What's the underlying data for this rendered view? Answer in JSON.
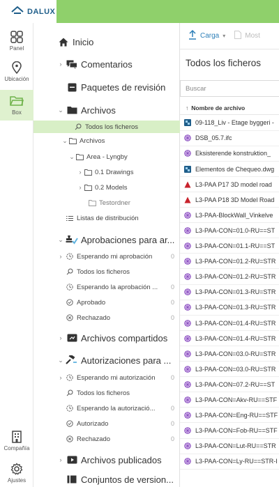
{
  "app": {
    "logo_text": "DALUX"
  },
  "rail": {
    "panel": "Panel",
    "location": "Ubicación",
    "box": "Box",
    "company": "Compañía",
    "settings": "Ajustes"
  },
  "nav": {
    "inicio": "Inicio",
    "comentarios": "Comentarios",
    "paquetes": "Paquetes de revisión",
    "archivos": "Archivos",
    "todos": "Todos los ficheros",
    "archivos_folder": "Archivos",
    "area": "Area - Lyngby",
    "drawings": "0.1 Drawings",
    "models": "0.2 Models",
    "testordner": "Testordner",
    "listas": "Listas de distribución",
    "aprobaciones": "Aprobaciones para ar...",
    "esperando_mi_aprob": "Esperando mi aprobación",
    "esperando_mi_aprob_count": "0",
    "aprob_todos": "Todos los ficheros",
    "esperando_aprob": "Esperando la aprobación ...",
    "esperando_aprob_count": "0",
    "aprobado": "Aprobado",
    "aprobado_count": "0",
    "rechazado": "Rechazado",
    "rechazado_count": "0",
    "compartidos": "Archivos compartidos",
    "autorizaciones": "Autorizaciones para ...",
    "esperando_mi_aut": "Esperando mi autorización",
    "esperando_mi_aut_count": "0",
    "aut_todos": "Todos los ficheros",
    "esperando_aut": "Esperando la autorizació...",
    "esperando_aut_count": "0",
    "autorizado": "Autorizado",
    "autorizado_count": "0",
    "aut_rechazado": "Rechazado",
    "aut_rechazado_count": "0",
    "publicados": "Archivos publicados",
    "conjuntos": "Conjuntos de version..."
  },
  "main": {
    "upload_label": "Carga",
    "show_label": "Most",
    "title": "Todos los ficheros",
    "search_placeholder": "Buscar",
    "col_name": "Nombre de archivo",
    "files": [
      {
        "name": "09-118_Liv - Etage byggeri -",
        "type": "ifc"
      },
      {
        "name": "DSB_05.7.ifc",
        "type": "mesh"
      },
      {
        "name": "Eksisterende konstruktion_",
        "type": "mesh"
      },
      {
        "name": "Elementos de Chequeo.dwg",
        "type": "ifc"
      },
      {
        "name": "L3-PAA P17 3D model road",
        "type": "pdf"
      },
      {
        "name": "L3-PAA P18 3D Model Road",
        "type": "pdf"
      },
      {
        "name": "L3-PAA-BlockWall_Vinkelve",
        "type": "mesh"
      },
      {
        "name": "L3-PAA-CON=01.0-RU==ST",
        "type": "mesh"
      },
      {
        "name": "L3-PAA-CON=01.1-RU==ST",
        "type": "mesh"
      },
      {
        "name": "L3-PAA-CON=01.2-RU=STR",
        "type": "mesh"
      },
      {
        "name": "L3-PAA-CON=01.2-RU=STR",
        "type": "mesh"
      },
      {
        "name": "L3-PAA-CON=01.3-RU=STR",
        "type": "mesh"
      },
      {
        "name": "L3-PAA-CON=01.3-RU=STR",
        "type": "mesh"
      },
      {
        "name": "L3-PAA-CON=01.4-RU=STR",
        "type": "mesh"
      },
      {
        "name": "L3-PAA-CON=01.4-RU=STR",
        "type": "mesh"
      },
      {
        "name": "L3-PAA-CON=03.0-RU=STR",
        "type": "mesh"
      },
      {
        "name": "L3-PAA-CON=03.0-RU=STR",
        "type": "mesh"
      },
      {
        "name": "L3-PAA-CON=07.2-RU==ST",
        "type": "mesh"
      },
      {
        "name": "L3-PAA-CON=Akv-RU==STF",
        "type": "mesh"
      },
      {
        "name": "L3-PAA-CON=Eng-RU==STF",
        "type": "mesh"
      },
      {
        "name": "L3-PAA-CON=Fob-RU==STF",
        "type": "mesh"
      },
      {
        "name": "L3-PAA-CON=Lut-RU==STR",
        "type": "mesh"
      },
      {
        "name": "L3-PAA-CON=Ly-RU==STR-I",
        "type": "mesh"
      }
    ]
  },
  "colors": {
    "topbar": "#8fd06b",
    "selected": "#d8efc6",
    "accent": "#2d7fb8",
    "logo": "#1f5e8a"
  }
}
